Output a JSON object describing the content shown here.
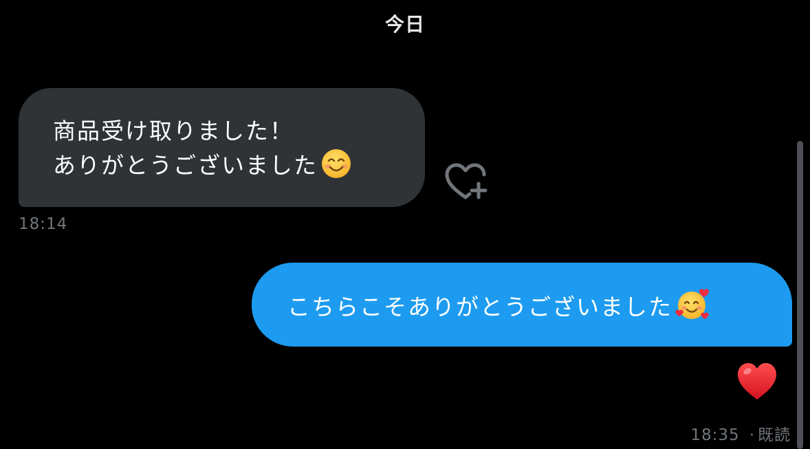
{
  "conversation": {
    "date_divider": "今日",
    "messages": [
      {
        "direction": "received",
        "lines": [
          "商品受け取りました！",
          "ありがとうございました"
        ],
        "emoji": "smiling-face-with-smiling-eyes",
        "timestamp": "18:14"
      },
      {
        "direction": "sent",
        "text": "こちらこそありがとうございました",
        "emoji": "smiling-face-with-hearts",
        "reaction": "red-heart",
        "timestamp": "18:35",
        "read_status": "既読"
      }
    ]
  },
  "actions": {
    "add_reaction_icon": "heart-plus-icon"
  },
  "colors": {
    "background": "#000000",
    "received_bubble": "#2f3336",
    "sent_bubble": "#1d9bf0",
    "timestamp": "#71767b",
    "reaction_heart": "#e0222e",
    "scrollbar": "#4d5054"
  }
}
